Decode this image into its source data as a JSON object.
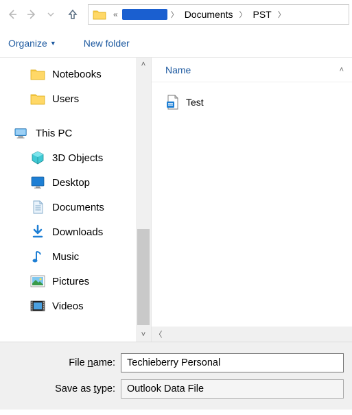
{
  "nav": {
    "back_enabled": false,
    "forward_enabled": false,
    "history_enabled": false,
    "up_enabled": true
  },
  "breadcrumb": {
    "parts": [
      "Documents",
      "PST"
    ]
  },
  "toolbar": {
    "organize": "Organize",
    "new_folder": "New folder"
  },
  "tree": {
    "folders": [
      {
        "label": "Notebooks",
        "icon": "folder-icon",
        "indent": 1
      },
      {
        "label": "Users",
        "icon": "folder-icon",
        "indent": 1
      }
    ],
    "this_pc": {
      "label": "This PC",
      "icon": "pc-icon"
    },
    "drives": [
      {
        "label": "3D Objects",
        "icon": "3d-objects-icon"
      },
      {
        "label": "Desktop",
        "icon": "desktop-icon"
      },
      {
        "label": "Documents",
        "icon": "documents-icon"
      },
      {
        "label": "Downloads",
        "icon": "downloads-icon"
      },
      {
        "label": "Music",
        "icon": "music-icon"
      },
      {
        "label": "Pictures",
        "icon": "pictures-icon"
      },
      {
        "label": "Videos",
        "icon": "videos-icon"
      }
    ]
  },
  "list": {
    "header_name": "Name",
    "items": [
      {
        "label": "Test",
        "icon": "pst-file-icon"
      }
    ]
  },
  "form": {
    "file_name_label_pre": "File ",
    "file_name_label_u": "n",
    "file_name_label_post": "ame:",
    "file_name_value": "Techieberry Personal",
    "save_type_label_pre": "Save as ",
    "save_type_label_u": "t",
    "save_type_label_post": "ype:",
    "save_type_value": "Outlook Data File"
  }
}
